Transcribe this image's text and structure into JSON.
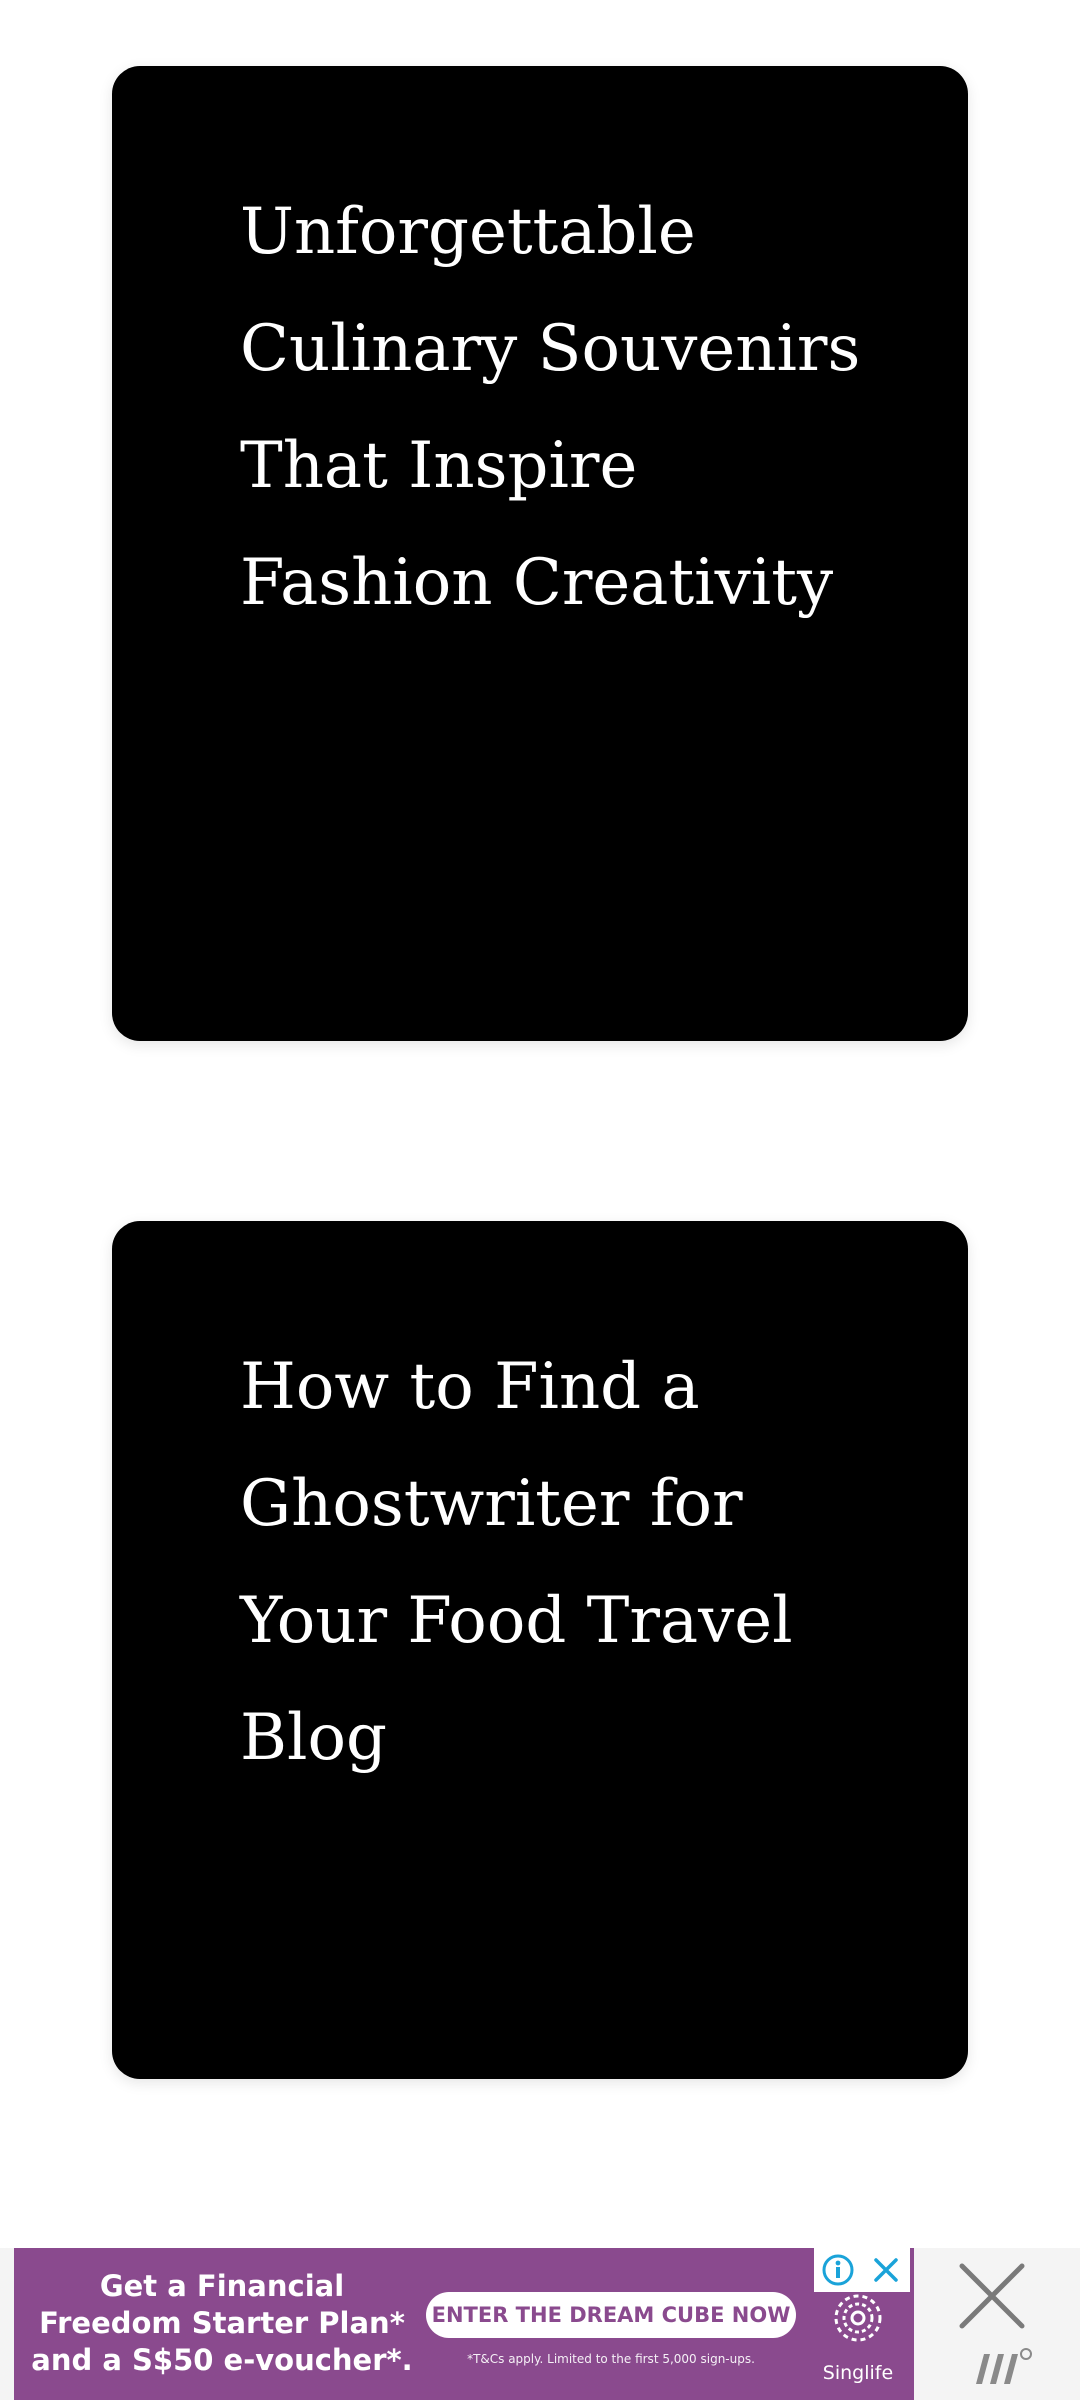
{
  "cards": [
    {
      "title": "Unforgettable Culinary Souvenirs That Inspire Fashion Creativity"
    },
    {
      "title": "How to Find a Ghostwriter for Your Food Travel Blog"
    }
  ],
  "ad": {
    "headline": "Get a Financial\nFreedom Starter Plan*\nand a S$50 e-voucher*.",
    "cta": "ENTER THE DREAM CUBE NOW",
    "fineprint": "*T&Cs apply. Limited to the first 5,000 sign-ups.",
    "brand": "Singlife",
    "background_color": "#8a4a8e",
    "adchoices_icons": [
      "info-icon",
      "close-icon"
    ],
    "close_icon": "close-ad-icon",
    "publisher_icon": "publisher-logo-icon"
  }
}
